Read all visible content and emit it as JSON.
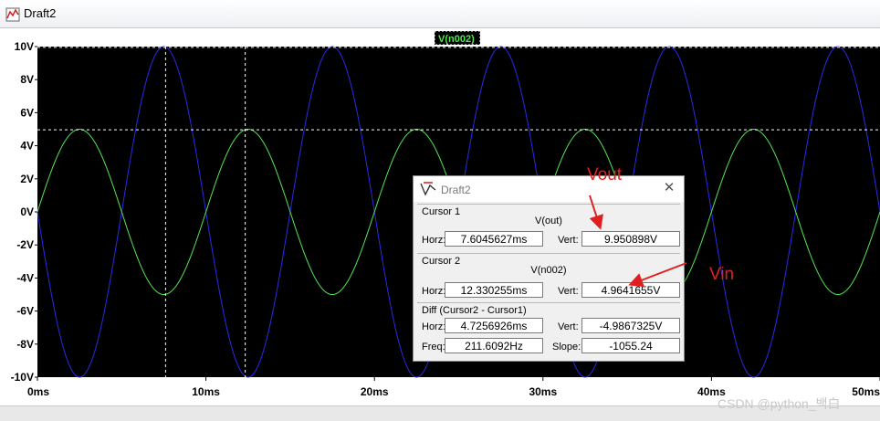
{
  "window": {
    "title": "Draft2"
  },
  "chart_data": {
    "type": "line",
    "title": "V(n002)",
    "x_ticks": [
      "0ms",
      "10ms",
      "20ms",
      "30ms",
      "40ms",
      "50ms"
    ],
    "y_ticks": [
      "10V",
      "8V",
      "6V",
      "4V",
      "2V",
      "0V",
      "-2V",
      "-4V",
      "-6V",
      "-8V",
      "-10V"
    ],
    "xlim": [
      0,
      50
    ],
    "ylim": [
      -10,
      10
    ],
    "x_unit": "ms",
    "series": [
      {
        "name": "V(out)",
        "color": "#2a2ae8",
        "amplitude": 10,
        "frequency_hz": 100,
        "phase": "inverted"
      },
      {
        "name": "V(n002)",
        "color": "#52e652",
        "amplitude": 5,
        "frequency_hz": 100,
        "phase": "normal"
      }
    ],
    "cursor1": {
      "x": 7.6045627,
      "y": 9.950898
    },
    "cursor2": {
      "x": 12.330255,
      "y": 4.9641655
    },
    "background": "#000000",
    "grid": false
  },
  "dialog": {
    "title": "Draft2",
    "close": "✕",
    "cursor1": {
      "heading": "Cursor 1",
      "trace": "V(out)",
      "horz_label": "Horz:",
      "horz": "7.6045627ms",
      "vert_label": "Vert:",
      "vert": "9.950898V"
    },
    "cursor2": {
      "heading": "Cursor 2",
      "trace": "V(n002)",
      "horz_label": "Horz:",
      "horz": "12.330255ms",
      "vert_label": "Vert:",
      "vert": "4.9641655V"
    },
    "diff": {
      "heading": "Diff (Cursor2 - Cursor1)",
      "horz_label": "Horz:",
      "horz": "4.7256926ms",
      "vert_label": "Vert:",
      "vert": "-4.9867325V",
      "freq_label": "Freq:",
      "freq": "211.6092Hz",
      "slope_label": "Slope:",
      "slope": "-1055.24"
    }
  },
  "annotations": {
    "vout": "Vout",
    "vin": "Vin"
  },
  "watermark": "CSDN @python_백白"
}
